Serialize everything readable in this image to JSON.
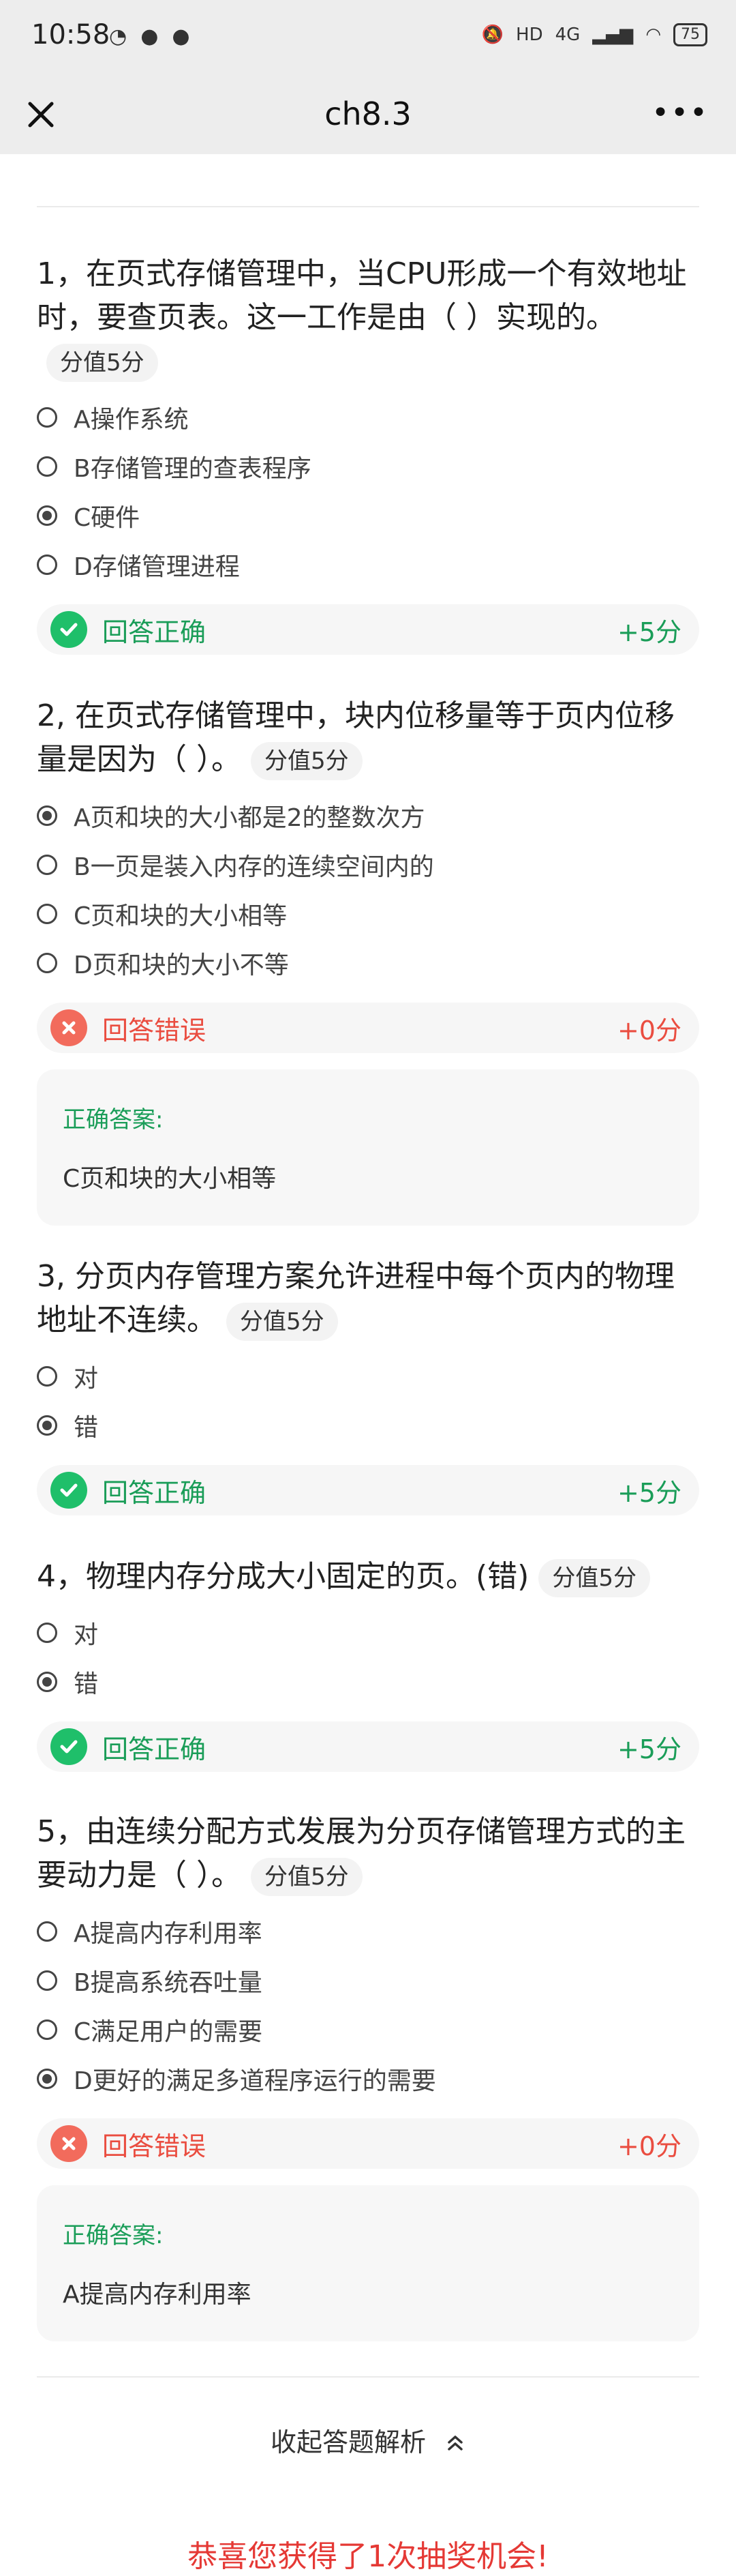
{
  "status_bar": {
    "time": "10:58",
    "icons_left": [
      "android-icon",
      "qq-icon",
      "chat-icon"
    ],
    "battery": "75",
    "network": "4G"
  },
  "nav": {
    "title": "ch8.3",
    "close_icon": "close-icon",
    "more_icon": "more-icon"
  },
  "questions": [
    {
      "title": "1，在页式存储管理中，当CPU形成一个有效地址时，要查页表。这一工作是由（ ）实现的。",
      "score": "分值5分",
      "options": [
        {
          "label": "A操作系统",
          "selected": false
        },
        {
          "label": "B存储管理的查表程序",
          "selected": false
        },
        {
          "label": "C硬件",
          "selected": true
        },
        {
          "label": "D存储管理进程",
          "selected": false
        }
      ],
      "result": {
        "text": "回答正确",
        "points": "+5分",
        "correct": true
      }
    },
    {
      "title": "2, 在页式存储管理中，块内位移量等于页内位移量是因为（ ）。",
      "score": "分值5分",
      "options": [
        {
          "label": "A页和块的大小都是2的整数次方",
          "selected": true
        },
        {
          "label": "B一页是装入内存的连续空间内的",
          "selected": false
        },
        {
          "label": "C页和块的大小相等",
          "selected": false
        },
        {
          "label": "D页和块的大小不等",
          "selected": false
        }
      ],
      "result": {
        "text": "回答错误",
        "points": "+0分",
        "correct": false
      },
      "answer_label": "正确答案:",
      "answer_value": "C页和块的大小相等"
    },
    {
      "title": "3, 分页内存管理方案允许进程中每个页内的物理地址不连续。",
      "score": "分值5分",
      "options": [
        {
          "label": "对",
          "selected": false
        },
        {
          "label": "错",
          "selected": true
        }
      ],
      "result": {
        "text": "回答正确",
        "points": "+5分",
        "correct": true
      }
    },
    {
      "title": "4，物理内存分成大小固定的页。(错)",
      "score": "分值5分",
      "options": [
        {
          "label": "对",
          "selected": false
        },
        {
          "label": "错",
          "selected": true
        }
      ],
      "result": {
        "text": "回答正确",
        "points": "+5分",
        "correct": true
      }
    },
    {
      "title": "5，由连续分配方式发展为分页存储管理方式的主要动力是（ ）。",
      "score": "分值5分",
      "options": [
        {
          "label": "A提高内存利用率",
          "selected": false
        },
        {
          "label": "B提高系统吞吐量",
          "selected": false
        },
        {
          "label": "C满足用户的需要",
          "selected": false
        },
        {
          "label": "D更好的满足多道程序运行的需要",
          "selected": true
        }
      ],
      "result": {
        "text": "回答错误",
        "points": "+0分",
        "correct": false
      },
      "answer_label": "正确答案:",
      "answer_value": "A提高内存利用率"
    }
  ],
  "footer": {
    "collapse_label": "收起答题解析",
    "congrats": "恭喜您获得了1次抽奖机会!"
  },
  "colors": {
    "correct": "#1fbf6a",
    "wrong": "#f26b5c",
    "congrats": "#e53935"
  }
}
